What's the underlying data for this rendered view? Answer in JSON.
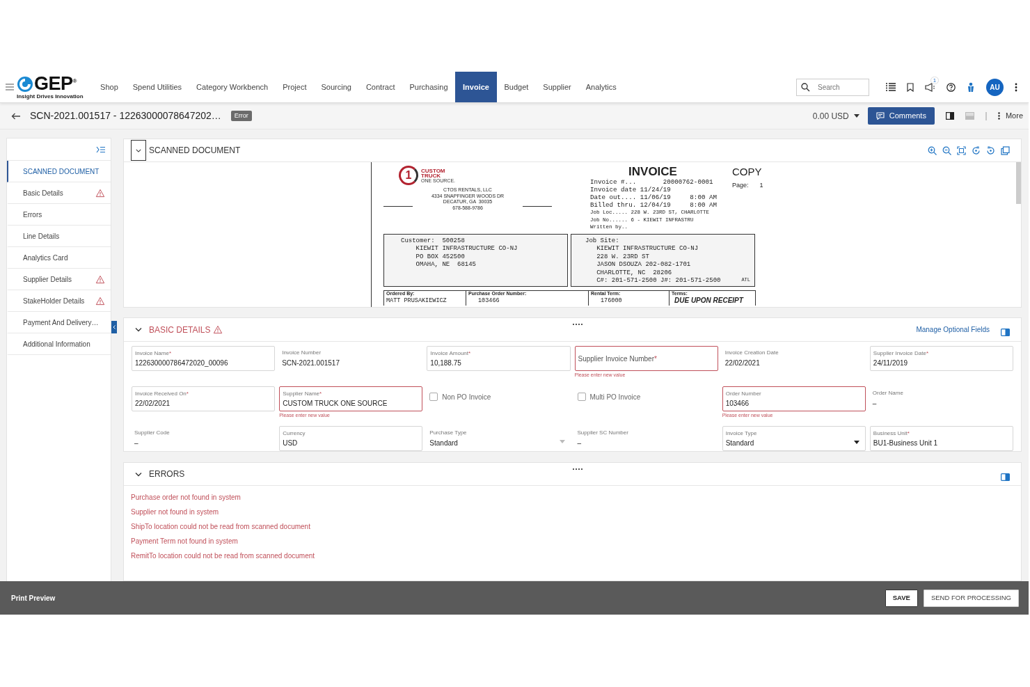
{
  "header": {
    "logo": {
      "wordmark": "GEP",
      "registered": "®",
      "tagline": "Insight Drives Innovation"
    },
    "nav": [
      {
        "label": "Shop",
        "selected": false
      },
      {
        "label": "Spend Utilities",
        "selected": false
      },
      {
        "label": "Category Workbench",
        "selected": false
      },
      {
        "label": "Project",
        "selected": false
      },
      {
        "label": "Sourcing",
        "selected": false
      },
      {
        "label": "Contract",
        "selected": false
      },
      {
        "label": "Purchasing",
        "selected": false
      },
      {
        "label": "Invoice",
        "selected": true
      },
      {
        "label": "Budget",
        "selected": false
      },
      {
        "label": "Supplier",
        "selected": false
      },
      {
        "label": "Analytics",
        "selected": false
      }
    ],
    "search": {
      "placeholder": "Search"
    },
    "notification_count": "1",
    "avatar": "AU"
  },
  "subheader": {
    "title": "SCN-2021.001517 - 12263000078647202…",
    "status": "Error",
    "amount": "0.00 USD",
    "comments": "Comments",
    "more": "More"
  },
  "sidebar": {
    "items": [
      {
        "label": "SCANNED DOCUMENT",
        "selected": true,
        "warning": false
      },
      {
        "label": "Basic Details",
        "selected": false,
        "warning": true
      },
      {
        "label": "Errors",
        "selected": false,
        "warning": false
      },
      {
        "label": "Line Details",
        "selected": false,
        "warning": false
      },
      {
        "label": "Analytics Card",
        "selected": false,
        "warning": false
      },
      {
        "label": "Supplier Details",
        "selected": false,
        "warning": true
      },
      {
        "label": "StakeHolder Details",
        "selected": false,
        "warning": true
      },
      {
        "label": "Payment And Delivery…",
        "selected": false,
        "warning": false
      },
      {
        "label": "Additional Information",
        "selected": false,
        "warning": false
      }
    ]
  },
  "scanned_document": {
    "title": "SCANNED DOCUMENT",
    "document": {
      "logo_mark": "1",
      "logo_lines": [
        "CUSTOM",
        "TRUCK",
        "ONE SOURCE."
      ],
      "company": [
        "CTOS RENTALS, LLC",
        "4334 SNAPFINGER WOODS DR",
        "DECATUR, GA  30035",
        "678-588-9786"
      ],
      "heading": "INVOICE",
      "copy": "COPY",
      "page_label": "Page:",
      "page": "1",
      "details": [
        "Invoice #...       20000762-0001",
        "Invoice date 11/24/19",
        "Date out.... 11/06/19     8:00 AM",
        "Billed thru. 12/04/19     8:00 AM"
      ],
      "job_details": [
        "Job Loc..... 228 W. 23RD ST, CHARLOTTE",
        "Job No...... 6 - KIEWIT INFRASTRU",
        "Written by.."
      ],
      "customer": {
        "label": "Customer:",
        "number": "500258",
        "lines": [
          "KIEWIT INFRASTRUCTURE CO-NJ",
          "PO BOX 452500",
          "OMAHA, NE  68145"
        ]
      },
      "job_site": {
        "label": "Job Site:",
        "lines": [
          "KIEWIT INFRASTRUCTURE CO-NJ",
          "228 W. 23RD ST",
          "JASON DSOUZA 202-082-1701",
          "CHARLOTTE, NC  28206",
          "C#: 201-571-2500 J#: 201-571-2500"
        ],
        "code": "ATL"
      },
      "summary": [
        {
          "label": "Ordered By:",
          "value": "MATT PRUSAKIEWICZ",
          "emphasis": false
        },
        {
          "label": "Purchase Order Number:",
          "value": "103466",
          "emphasis": false
        },
        {
          "label": "Rental Term:",
          "value": "176000",
          "emphasis": false
        },
        {
          "label": "Terms:",
          "value": "DUE UPON RECEIPT",
          "emphasis": true
        }
      ]
    }
  },
  "basic_details": {
    "title": "BASIC DETAILS",
    "warning": true,
    "manage_link": "Manage Optional Fields",
    "fields": [
      {
        "kind": "input",
        "label": "Invoice Name",
        "mark": "*",
        "value": "122630000786472020_00096"
      },
      {
        "kind": "text",
        "label": "Invoice Number",
        "value": "SCN-2021.001517"
      },
      {
        "kind": "input",
        "label": "Invoice Amount",
        "mark": "*",
        "value": "10,188.75"
      },
      {
        "kind": "input",
        "label": "Supplier Invoice Number",
        "mark": "*",
        "error": "Please enter new value"
      },
      {
        "kind": "text",
        "label": "Invoice Creation Date",
        "value": "22/02/2021"
      },
      {
        "kind": "input",
        "label": "Supplier Invoice Date",
        "mark": "*",
        "value": "24/11/2019"
      },
      {
        "kind": "input",
        "label": "Invoice Received On",
        "mark": "*",
        "value": "22/02/2021"
      },
      {
        "kind": "input",
        "label": "Supplier Name",
        "mark": "*",
        "value": "CUSTOM TRUCK ONE SOURCE",
        "error": "Please enter new value"
      },
      {
        "kind": "checkbox",
        "label": "Non PO Invoice",
        "checked": false
      },
      {
        "kind": "checkbox",
        "label": "Multi PO Invoice",
        "checked": false
      },
      {
        "kind": "input",
        "label": "Order Number",
        "value": "103466",
        "error": "Please enter new value"
      },
      {
        "kind": "text",
        "label": "Order Name",
        "value": "–"
      },
      {
        "kind": "text",
        "label": "Supplier Code",
        "value": "–"
      },
      {
        "kind": "input",
        "label": "Currency",
        "value": "USD"
      },
      {
        "kind": "text",
        "label": "Purchase Type",
        "value": "Standard",
        "dropdown": true
      },
      {
        "kind": "text",
        "label": "Supplier SC Number",
        "value": "–"
      },
      {
        "kind": "input",
        "label": "Invoice Type",
        "value": "Standard",
        "dropdown": true
      },
      {
        "kind": "input",
        "label": "Business Unit",
        "mark": "*",
        "value": "BU1-Business Unit 1"
      }
    ]
  },
  "errors": {
    "title": "ERRORS",
    "items": [
      "Purchase order not found in system",
      "Supplier not found in system",
      "ShipTo location could not be read from scanned document",
      "Payment Term not found in system",
      "RemitTo location could not be read from scanned document"
    ]
  },
  "footer": {
    "print_preview": "Print Preview",
    "buttons": [
      {
        "label": "SAVE",
        "kind": "primary"
      },
      {
        "label": "SEND FOR PROCESSING",
        "kind": "secondary"
      }
    ]
  }
}
